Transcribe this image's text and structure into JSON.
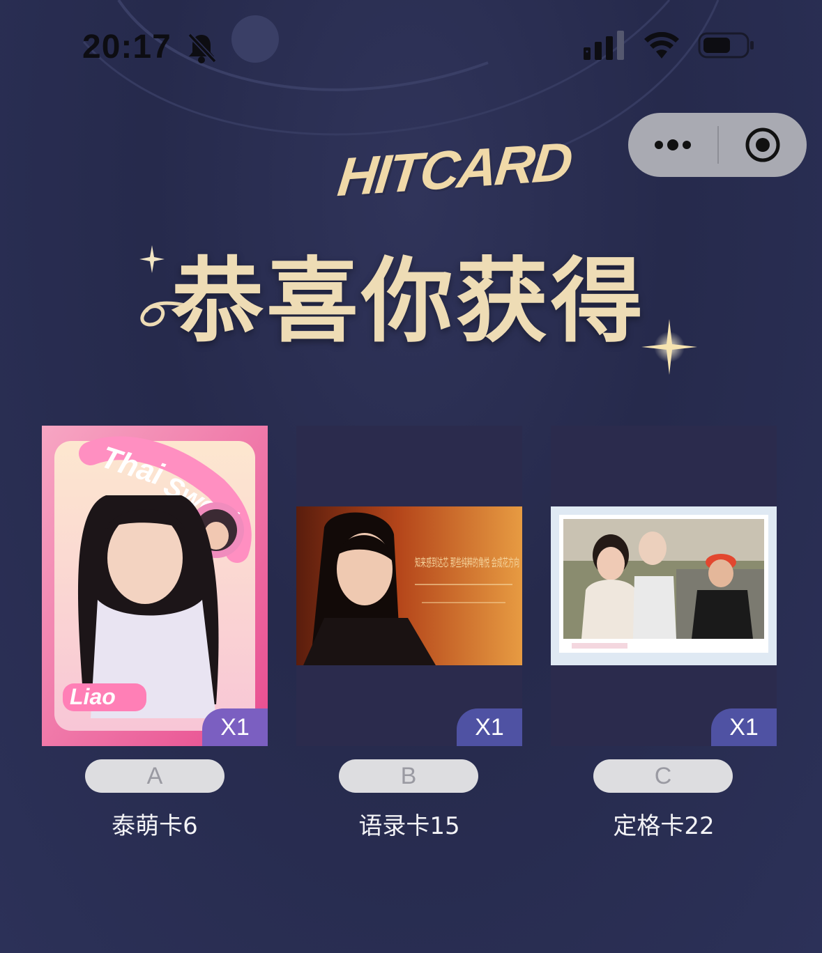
{
  "status_bar": {
    "time": "20:17",
    "icons": [
      "bell-slash-icon",
      "signal-icon",
      "wifi-icon",
      "battery-icon"
    ]
  },
  "capsule": {
    "more_icon": "more-dots-icon",
    "close_icon": "target-close-icon"
  },
  "header": {
    "logo_text": "HITCARD",
    "congrats_text": "恭喜你获得"
  },
  "cards": [
    {
      "option": "A",
      "name": "泰萌卡6",
      "count": "X1",
      "image": "portrait-pink-frame",
      "image_text": [
        "Thai",
        "Sweet",
        "Liao"
      ]
    },
    {
      "option": "B",
      "name": "语录卡15",
      "count": "X1",
      "image": "quote-landscape",
      "image_text": "知来感到达芯 那些纯粹的角悦 会成花方向"
    },
    {
      "option": "C",
      "name": "定格卡22",
      "count": "X1",
      "image": "still-frame-group"
    }
  ],
  "colors": {
    "background": "#2a2e52",
    "gold": "#eedcb5",
    "badge": "#4f52a3",
    "option_pill": "#dddde0",
    "card_bg": "#2b2b4d"
  }
}
